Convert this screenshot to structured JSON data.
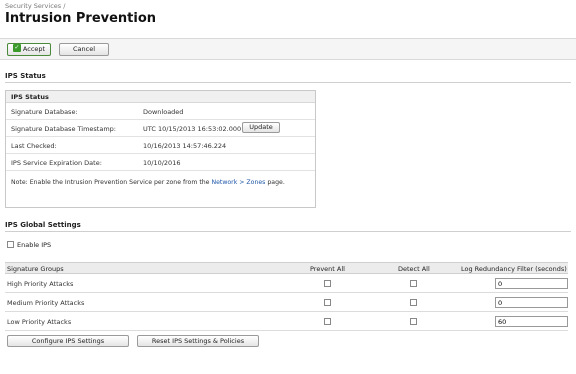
{
  "breadcrumb": "Security Services /",
  "page_title": "Intrusion Prevention",
  "toolbar": {
    "accept_label": "Accept",
    "cancel_label": "Cancel"
  },
  "ips_status": {
    "section_title": "IPS Status",
    "box_title": "IPS Status",
    "rows": [
      {
        "label": "Signature Database:",
        "value": "Downloaded"
      },
      {
        "label": "Signature Database Timestamp:",
        "value": "UTC 10/15/2013 16:53:02.000"
      },
      {
        "label": "Last Checked:",
        "value": "10/16/2013 14:57:46.224"
      },
      {
        "label": "IPS Service Expiration Date:",
        "value": "10/10/2016"
      }
    ],
    "update_label": "Update",
    "note_prefix": "Note: Enable the Intrusion Prevention Service per zone from the",
    "note_link": "Network > Zones",
    "note_suffix": "page."
  },
  "global_settings": {
    "section_title": "IPS Global Settings",
    "enable_label": "Enable IPS",
    "enable_checked": false,
    "columns": [
      "Signature Groups",
      "Prevent All",
      "Detect All",
      "Log Redundancy Filter (seconds)"
    ],
    "rows": [
      {
        "name": "High Priority Attacks",
        "prevent": false,
        "detect": false,
        "filter": "0"
      },
      {
        "name": "Medium Priority Attacks",
        "prevent": false,
        "detect": false,
        "filter": "0"
      },
      {
        "name": "Low Priority Attacks",
        "prevent": false,
        "detect": false,
        "filter": "60"
      }
    ],
    "configure_label": "Configure IPS Settings",
    "reset_label": "Reset IPS Settings & Policies"
  }
}
